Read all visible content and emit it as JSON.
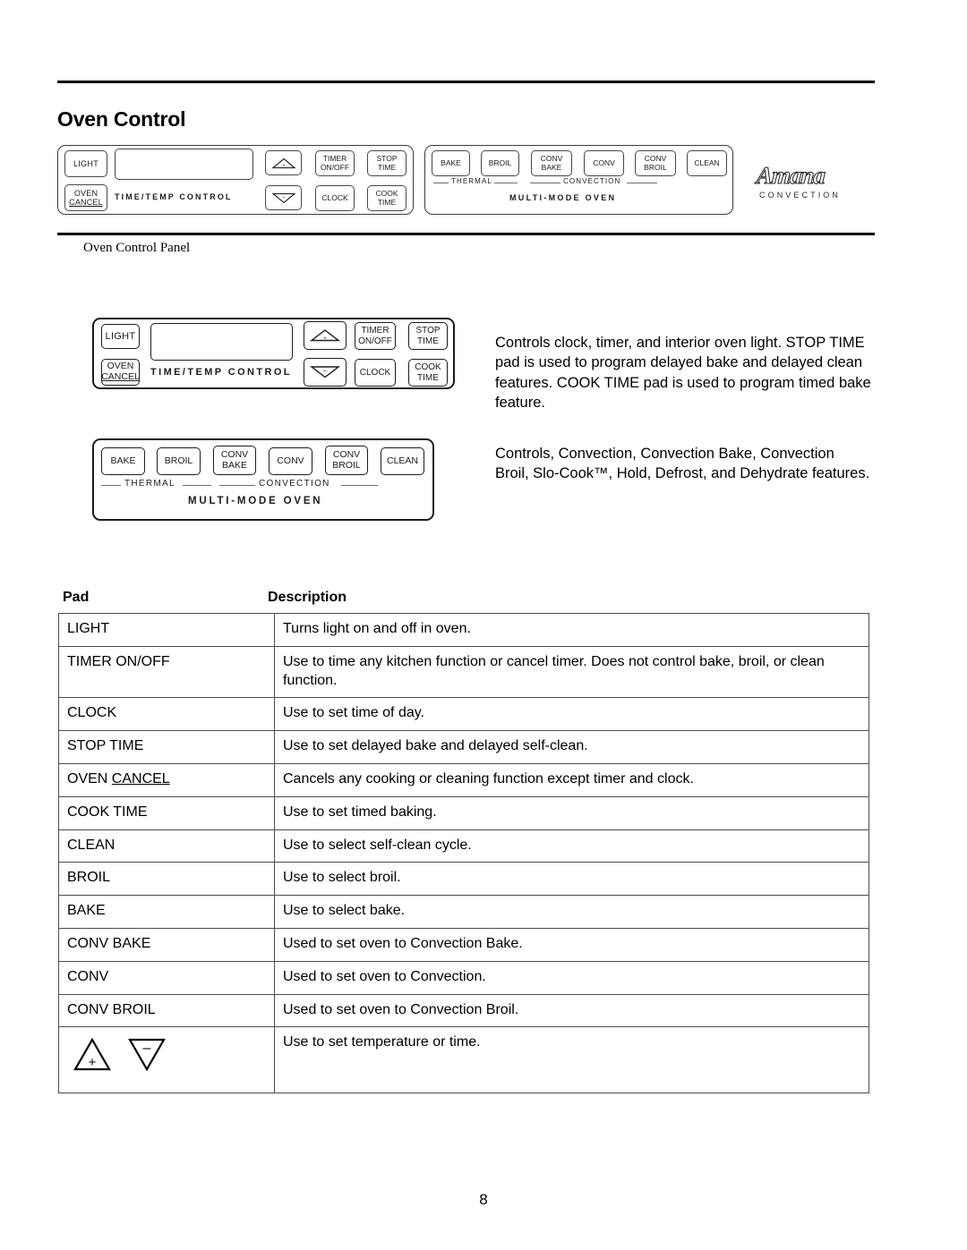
{
  "document": {
    "section_title": "Oven Control",
    "figure_caption": "Oven Control Panel",
    "page_number": "8"
  },
  "control_panel": {
    "time_temp_group": {
      "group_label": "TIME/TEMP CONTROL",
      "pads": {
        "light": "LIGHT",
        "oven_cancel_line1": "OVEN",
        "oven_cancel_line2": "CANCEL",
        "up_arrow": "up-arrow-plus",
        "down_arrow": "down-arrow-minus",
        "timer_line1": "TIMER",
        "timer_line2": "ON/OFF",
        "stop_time_line1": "STOP",
        "stop_time_line2": "TIME",
        "clock": "CLOCK",
        "cook_time_line1": "COOK",
        "cook_time_line2": "TIME"
      }
    },
    "multimode_group": {
      "pads": {
        "bake": "BAKE",
        "broil": "BROIL",
        "conv_bake_line1": "CONV",
        "conv_bake_line2": "BAKE",
        "conv": "CONV",
        "conv_broil_line1": "CONV",
        "conv_broil_line2": "BROIL",
        "clean": "CLEAN"
      },
      "thermal_label": "THERMAL",
      "convection_label": "CONVECTION",
      "title_label": "MULTI-MODE OVEN"
    },
    "brand": {
      "wordmark": "Amana",
      "tagline": "CONVECTION"
    }
  },
  "descriptions": {
    "time_temp": "Controls clock, timer, and interior oven light. STOP TIME pad is used to program delayed bake and delayed clean features. COOK TIME pad is used to program timed bake feature.",
    "multimode": "Controls, Convection, Convection Bake, Convection Broil, Slo-Cook™, Hold, Defrost, and Dehydrate features."
  },
  "table": {
    "headers": {
      "pad": "Pad",
      "description": "Description"
    },
    "rows": [
      {
        "pad": "LIGHT",
        "description": "Turns light on and off in oven."
      },
      {
        "pad": "TIMER ON/OFF",
        "description": "Use to time any kitchen function or cancel timer. Does not control bake, broil, or clean function."
      },
      {
        "pad": "CLOCK",
        "description": "Use to set time of day."
      },
      {
        "pad": "STOP TIME",
        "description": "Use to set delayed bake and delayed self-clean."
      },
      {
        "pad": "OVEN CANCEL",
        "pad_prefix": "OVEN ",
        "pad_underlined": "CANCEL",
        "description": "Cancels any cooking or cleaning function except timer and clock."
      },
      {
        "pad": "COOK TIME",
        "description": "Use to set timed baking."
      },
      {
        "pad": "CLEAN",
        "description": "Use to select self-clean cycle."
      },
      {
        "pad": "BROIL",
        "description": "Use to select broil."
      },
      {
        "pad": "BAKE",
        "description": "Use to select bake."
      },
      {
        "pad": "CONV BAKE",
        "description": "Used to set oven to Convection Bake."
      },
      {
        "pad": "CONV",
        "description": "Used to set oven to Convection."
      },
      {
        "pad": "CONV BROIL",
        "description": "Used to set oven to Convection Broil."
      },
      {
        "pad": "up-down-arrow-icons",
        "description": "Use to set temperature or time."
      }
    ]
  }
}
